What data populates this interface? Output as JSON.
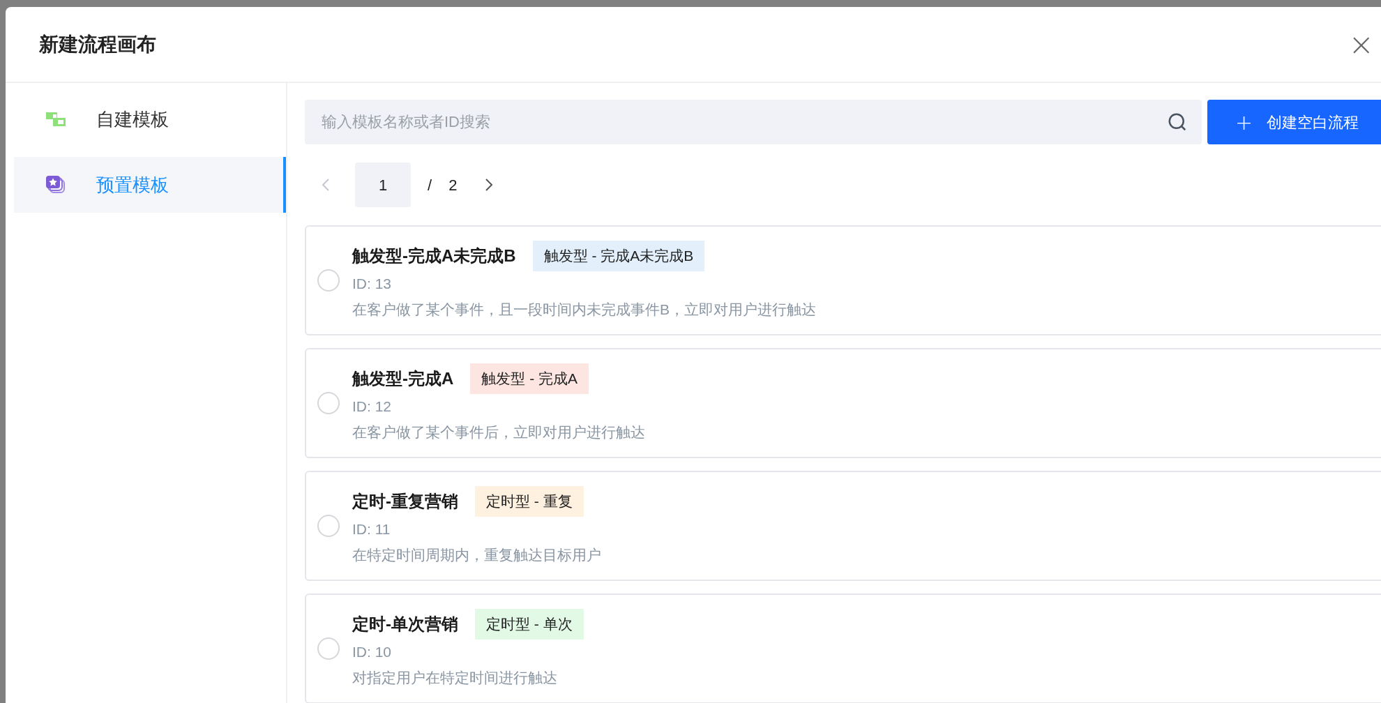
{
  "dialog": {
    "title": "新建流程画布",
    "close": "×"
  },
  "sidebar": {
    "items": [
      {
        "label": "自建模板",
        "kind": "custom",
        "selected": false
      },
      {
        "label": "预置模板",
        "kind": "preset",
        "selected": true
      }
    ]
  },
  "search": {
    "placeholder": "输入模板名称或者ID搜索"
  },
  "create_button": {
    "icon": "+",
    "label": "创建空白流程"
  },
  "pagination": {
    "current": "1",
    "separator": "/",
    "total": "2"
  },
  "templates": [
    {
      "title": "触发型-完成A未完成B",
      "tag": "触发型 - 完成A未完成B",
      "color": "#e3f0fc",
      "id": "ID: 13",
      "description": "在客户做了某个事件，且一段时间内未完成事件B，立即对用户进行触达",
      "selected": false
    },
    {
      "title": "触发型-完成A",
      "tag": "触发型 - 完成A",
      "color": "#fde6e2",
      "id": "ID: 12",
      "description": "在客户做了某个事件后，立即对用户进行触达",
      "selected": false
    },
    {
      "title": "定时-重复营销",
      "tag": "定时型 - 重复",
      "color": "#fff1e0",
      "id": "ID: 11",
      "description": "在特定时间周期内，重复触达目标用户",
      "selected": false
    },
    {
      "title": "定时-单次营销",
      "tag": "定时型 - 单次",
      "color": "#e2f9e6",
      "id": "ID: 10",
      "description": "对指定用户在特定时间进行触达",
      "selected": false
    }
  ]
}
